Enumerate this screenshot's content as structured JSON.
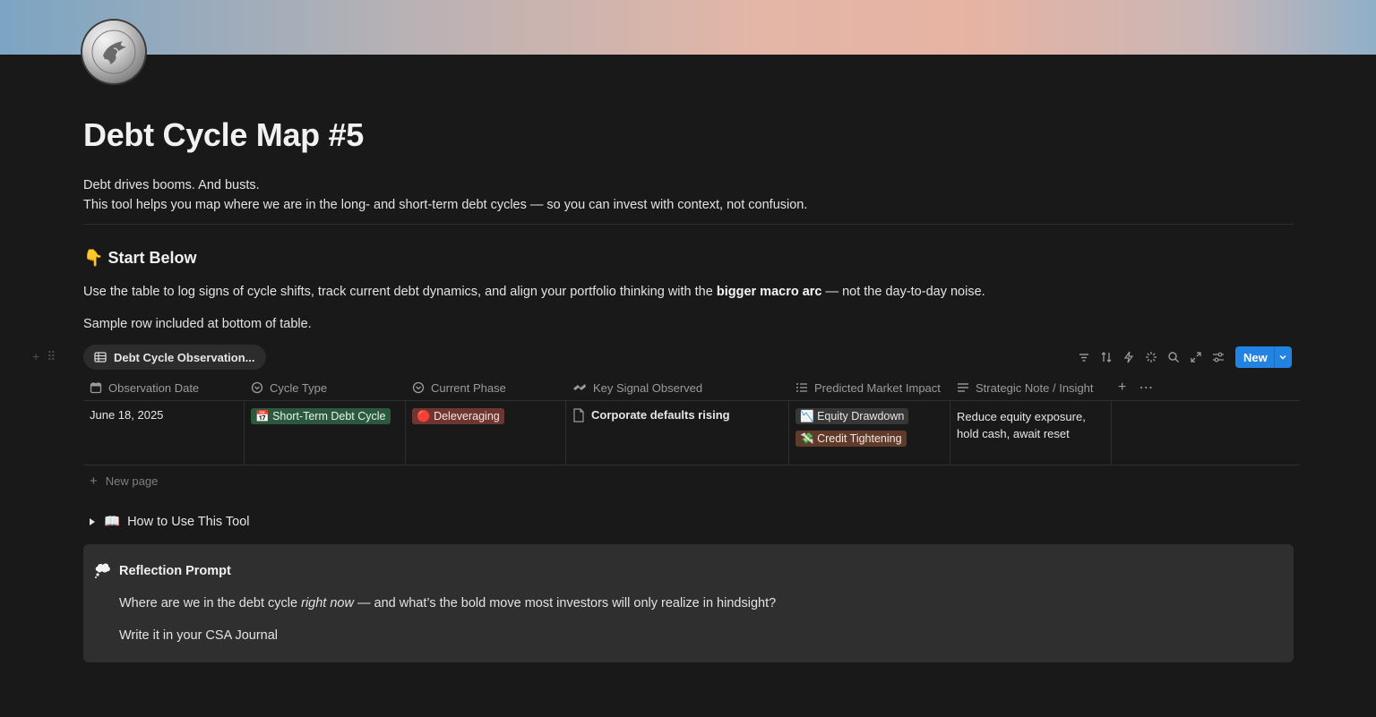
{
  "page": {
    "title": "Debt Cycle Map #5",
    "intro_line1": "Debt drives booms. And busts.",
    "intro_line2": "This tool helps you map where we are in the long- and short-term debt cycles — so you can invest with context, not confusion.",
    "section_heading_emoji": "👇",
    "section_heading": "Start Below",
    "instructions_before": "Use the table to log signs of cycle shifts, track current debt dynamics, and align your portfolio thinking with the ",
    "instructions_bold": "bigger macro arc",
    "instructions_after": " — not the day-to-day noise.",
    "sample_note": "Sample row included at bottom of table."
  },
  "database": {
    "view_name": "Debt Cycle Observation...",
    "new_button_label": "New",
    "columns": [
      {
        "label": "Observation Date",
        "icon": "calendar-icon"
      },
      {
        "label": "Cycle Type",
        "icon": "select-icon"
      },
      {
        "label": "Current Phase",
        "icon": "select-icon"
      },
      {
        "label": "Key Signal Observed",
        "icon": "title-icon"
      },
      {
        "label": "Predicted Market Impact",
        "icon": "multi-select-icon"
      },
      {
        "label": "Strategic Note / Insight",
        "icon": "text-icon"
      }
    ],
    "rows": [
      {
        "observation_date": "June 18, 2025",
        "cycle_type": {
          "emoji": "📅",
          "label": "Short-Term Debt Cycle",
          "color": "#2b593f"
        },
        "current_phase": {
          "emoji": "🔴",
          "label": "Deleveraging",
          "color": "#6e3630"
        },
        "key_signal": "Corporate defaults rising",
        "market_impact": [
          {
            "emoji": "📉",
            "label": "Equity Drawdown",
            "color": "#373737"
          },
          {
            "emoji": "💸",
            "label": "Credit Tightening",
            "color": "#603b2c"
          }
        ],
        "strategic_note_line1": "Reduce equity exposure,",
        "strategic_note_line2": "hold cash, await reset"
      }
    ],
    "new_page_label": "New page"
  },
  "toggle": {
    "emoji": "📖",
    "label": "How to Use This Tool"
  },
  "callout": {
    "title": "Reflection Prompt",
    "prompt_before": "Where are we in the debt cycle ",
    "prompt_italic": "right now",
    "prompt_after": " — and what’s the bold move most investors will only realize in hindsight?",
    "action": "Write it in your CSA Journal"
  },
  "colors": {
    "background": "#191919",
    "accent_blue": "#2383e2",
    "callout_bg": "#2f2f2f"
  }
}
